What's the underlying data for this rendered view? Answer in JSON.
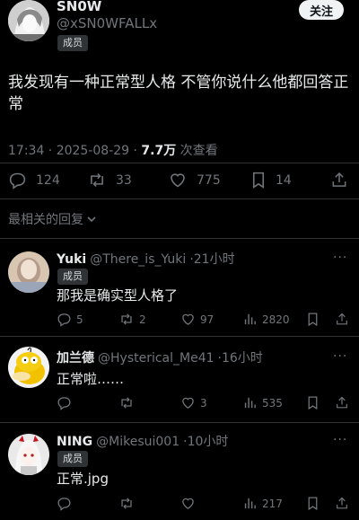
{
  "post": {
    "author_name": "SN0W",
    "author_handle": "@xSN0WFALLx",
    "badge": "成员",
    "follow_label": "关注",
    "text": "我发现有一种正常型人格 不管你说什么他都回答正常",
    "time": "17:34 · 2025-08-29 · ",
    "views": "7.7万",
    "views_label": " 次查看",
    "replies": "124",
    "reposts": "33",
    "likes": "775",
    "bookmarks": "14"
  },
  "sort_label": "最相关的回复",
  "replies": [
    {
      "name": "Yuki",
      "handle": "@There_is_Yuki",
      "time": "21小时",
      "badge": "成员",
      "text": "那我是确实型人格了",
      "replies": "5",
      "reposts": "2",
      "likes": "97",
      "views": "2820",
      "more": "···"
    },
    {
      "name": "加兰德",
      "handle": "@Hysterical_Me41",
      "time": "16小时",
      "text": "正常啦……",
      "replies": "",
      "reposts": "",
      "likes": "3",
      "views": "535",
      "more": "···"
    },
    {
      "name": "NING",
      "handle": "@Mikesui001",
      "time": "10小时",
      "badge": "成员",
      "text": "正常.jpg",
      "replies": "",
      "reposts": "",
      "likes": "",
      "views": "217",
      "more": "···"
    }
  ],
  "colors": {
    "background": "#000000",
    "text": "#e7e9ea",
    "muted": "#71767b",
    "divider": "#2f3336"
  }
}
